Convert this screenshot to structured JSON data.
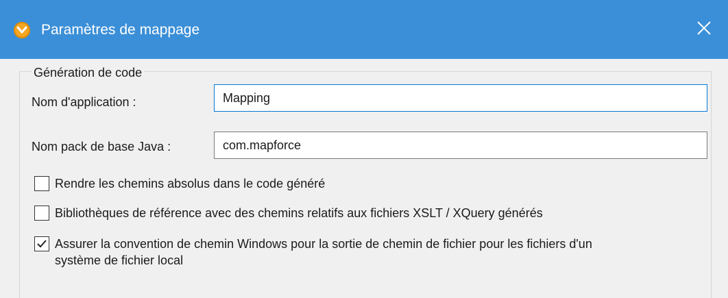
{
  "window": {
    "title": "Paramètres de mappage"
  },
  "group": {
    "legend": "Génération de code"
  },
  "fields": {
    "app_name_label": "Nom d'application :",
    "app_name_value": "Mapping",
    "java_pack_label": "Nom pack de base Java :",
    "java_pack_value": "com.mapforce"
  },
  "checkboxes": [
    {
      "label": "Rendre les chemins absolus dans le code généré",
      "checked": false
    },
    {
      "label": "Bibliothèques de référence avec des chemins relatifs aux fichiers XSLT / XQuery générés",
      "checked": false
    },
    {
      "label_line1": "Assurer la convention de chemin Windows pour la sortie de chemin de fichier pour les fichiers d'un",
      "label_line2": "système de fichier local",
      "checked": true
    }
  ],
  "colors": {
    "titlebar": "#3b8fd8",
    "focus_border": "#0078d7"
  },
  "icons": {
    "app": "mapforce-logo-icon",
    "close": "close-icon",
    "check": "checkmark-icon"
  }
}
